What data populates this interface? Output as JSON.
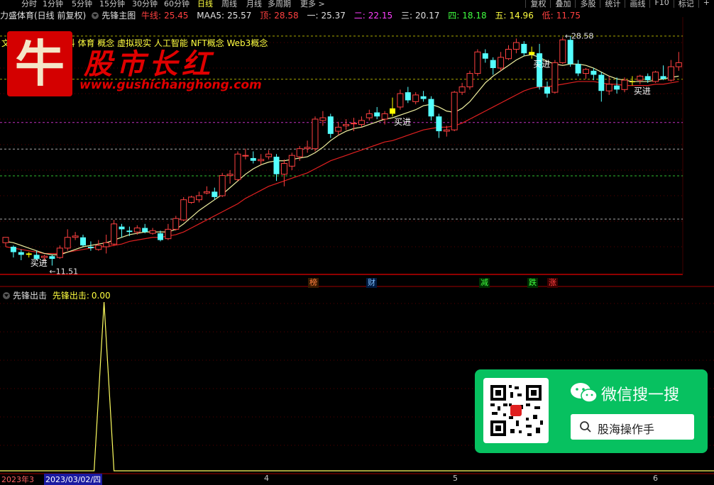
{
  "toolbar": {
    "periods": [
      "分时",
      "1分钟",
      "5分钟",
      "15分钟",
      "30分钟",
      "60分钟",
      "日线",
      "周线",
      "月线",
      "多周期",
      "更多 >"
    ],
    "active_period": "日线",
    "right_tools": [
      "复权",
      "叠加",
      "多股",
      "统计",
      "画线",
      "F10",
      "标记",
      "+"
    ]
  },
  "infobar": {
    "stock": "力盛体育(日线 前复权)",
    "indicator": "先锋主图",
    "niu_label": "牛线:",
    "niu_value": "25.45",
    "maa5_label": "MAA5:",
    "maa5_value": "25.57",
    "top_label": "顶:",
    "top_value": "28.58",
    "l1_label": "一:",
    "l1_value": "25.37",
    "l2_label": "二:",
    "l2_value": "22.15",
    "l3_label": "三:",
    "l3_value": "20.17",
    "l4_label": "四:",
    "l4_value": "18.18",
    "l5_label": "五:",
    "l5_value": "14.96",
    "low_label": "低:",
    "low_value": "11.75"
  },
  "concepts": "文旅  海板块 新材料 体育 概念 虚拟现实 人工智能 NFT概念 Web3概念",
  "watermark": {
    "logo_char": "牛",
    "title": "股市长红",
    "url": "www.gushichanghong.com"
  },
  "annotations": {
    "high_marker": "28.58",
    "low_marker": "11.51",
    "buy_label": "买进"
  },
  "event_badges": [
    {
      "text": "榜",
      "color": "#ff8040",
      "bg": "#3a1a00"
    },
    {
      "text": "财",
      "color": "#80c0ff",
      "bg": "#001a40"
    },
    {
      "text": "减",
      "color": "#40ff40",
      "bg": "#003000"
    },
    {
      "text": "跌",
      "color": "#40ff40",
      "bg": "#003000"
    },
    {
      "text": "涨",
      "color": "#ff4040",
      "bg": "#400000"
    }
  ],
  "sub_panel": {
    "name": "先锋出击",
    "value_label": "先锋出击:",
    "value": "0.00"
  },
  "date_axis": {
    "start_label": "2023年3",
    "current_date": "2023/03/02/四",
    "month_labels": [
      "4",
      "5",
      "6"
    ]
  },
  "wechat": {
    "title": "微信搜一搜",
    "search_text": "股海操作手"
  },
  "chart_data": {
    "type": "candlestick",
    "title": "力盛体育(日线 前复权)",
    "ylim": [
      11.0,
      30.0
    ],
    "candles": [
      {
        "o": 13.2,
        "h": 13.4,
        "c": 13.6,
        "l": 12.9
      },
      {
        "o": 12.9,
        "h": 13.0,
        "c": 12.5,
        "l": 12.1
      },
      {
        "o": 12.5,
        "h": 12.7,
        "c": 12.3,
        "l": 11.9
      },
      {
        "o": 12.3,
        "h": 12.5,
        "c": 12.4,
        "l": 12.1
      },
      {
        "o": 12.3,
        "h": 12.6,
        "c": 12.0,
        "l": 11.9
      },
      {
        "o": 12.1,
        "h": 12.3,
        "c": 12.2,
        "l": 11.9
      },
      {
        "o": 12.2,
        "h": 12.3,
        "c": 12.0,
        "l": 11.5
      },
      {
        "o": 12.1,
        "h": 13.0,
        "c": 12.8,
        "l": 12.0
      },
      {
        "o": 12.8,
        "h": 14.2,
        "c": 13.6,
        "l": 12.6
      },
      {
        "o": 13.6,
        "h": 14.0,
        "c": 13.7,
        "l": 13.4
      },
      {
        "o": 13.6,
        "h": 13.8,
        "c": 13.0,
        "l": 12.9
      },
      {
        "o": 12.9,
        "h": 13.3,
        "c": 12.8,
        "l": 12.6
      },
      {
        "o": 12.7,
        "h": 13.4,
        "c": 13.0,
        "l": 12.6
      },
      {
        "o": 12.9,
        "h": 13.8,
        "c": 13.2,
        "l": 12.4
      },
      {
        "o": 13.1,
        "h": 14.9,
        "c": 14.6,
        "l": 13.0
      },
      {
        "o": 14.4,
        "h": 14.6,
        "c": 14.2,
        "l": 13.6
      },
      {
        "o": 14.1,
        "h": 14.4,
        "c": 14.0,
        "l": 13.7
      },
      {
        "o": 14.0,
        "h": 14.5,
        "c": 14.3,
        "l": 13.8
      },
      {
        "o": 14.3,
        "h": 14.6,
        "c": 14.0,
        "l": 13.9
      },
      {
        "o": 13.9,
        "h": 14.3,
        "c": 14.1,
        "l": 13.8
      },
      {
        "o": 13.9,
        "h": 14.1,
        "c": 13.4,
        "l": 13.3
      },
      {
        "o": 13.5,
        "h": 14.6,
        "c": 14.2,
        "l": 13.4
      },
      {
        "o": 14.2,
        "h": 15.2,
        "c": 15.0,
        "l": 14.1
      },
      {
        "o": 14.9,
        "h": 16.6,
        "c": 16.4,
        "l": 14.8
      },
      {
        "o": 16.2,
        "h": 16.7,
        "c": 16.6,
        "l": 16.1
      },
      {
        "o": 16.4,
        "h": 17.0,
        "c": 16.7,
        "l": 16.2
      },
      {
        "o": 16.9,
        "h": 17.4,
        "c": 17.0,
        "l": 16.8
      },
      {
        "o": 17.0,
        "h": 17.3,
        "c": 16.6,
        "l": 16.4
      },
      {
        "o": 16.7,
        "h": 18.4,
        "c": 18.2,
        "l": 16.6
      },
      {
        "o": 18.2,
        "h": 18.6,
        "c": 18.3,
        "l": 17.6
      },
      {
        "o": 17.9,
        "h": 20.0,
        "c": 19.8,
        "l": 17.8
      },
      {
        "o": 19.7,
        "h": 20.2,
        "c": 19.7,
        "l": 19.4
      },
      {
        "o": 19.5,
        "h": 20.0,
        "c": 19.3,
        "l": 19.1
      },
      {
        "o": 19.3,
        "h": 19.8,
        "c": 19.4,
        "l": 19.0
      },
      {
        "o": 19.6,
        "h": 20.1,
        "c": 19.8,
        "l": 19.4
      },
      {
        "o": 19.6,
        "h": 19.8,
        "c": 18.3,
        "l": 17.8
      },
      {
        "o": 18.3,
        "h": 19.4,
        "c": 19.1,
        "l": 17.4
      },
      {
        "o": 18.9,
        "h": 19.9,
        "c": 19.7,
        "l": 18.6
      },
      {
        "o": 19.6,
        "h": 20.4,
        "c": 20.2,
        "l": 19.3
      },
      {
        "o": 20.2,
        "h": 20.8,
        "c": 20.3,
        "l": 19.9
      },
      {
        "o": 20.2,
        "h": 22.6,
        "c": 22.4,
        "l": 20.0
      },
      {
        "o": 22.3,
        "h": 23.0,
        "c": 22.5,
        "l": 21.9
      },
      {
        "o": 22.6,
        "h": 22.8,
        "c": 21.3,
        "l": 21.0
      },
      {
        "o": 21.5,
        "h": 22.2,
        "c": 21.8,
        "l": 21.2
      },
      {
        "o": 21.9,
        "h": 22.4,
        "c": 22.0,
        "l": 21.6
      },
      {
        "o": 22.1,
        "h": 22.5,
        "c": 22.1,
        "l": 21.5
      },
      {
        "o": 22.0,
        "h": 22.6,
        "c": 22.3,
        "l": 21.8
      },
      {
        "o": 22.5,
        "h": 23.1,
        "c": 22.8,
        "l": 22.3
      },
      {
        "o": 22.9,
        "h": 23.3,
        "c": 22.6,
        "l": 22.4
      },
      {
        "o": 22.4,
        "h": 23.0,
        "c": 22.8,
        "l": 22.0
      },
      {
        "o": 22.8,
        "h": 24.0,
        "c": 23.2,
        "l": 22.6
      },
      {
        "o": 23.3,
        "h": 24.6,
        "c": 24.3,
        "l": 23.1
      },
      {
        "o": 24.4,
        "h": 24.8,
        "c": 23.8,
        "l": 23.6
      },
      {
        "o": 23.7,
        "h": 24.4,
        "c": 24.2,
        "l": 23.5
      },
      {
        "o": 24.1,
        "h": 24.5,
        "c": 23.9,
        "l": 23.7
      },
      {
        "o": 23.9,
        "h": 24.1,
        "c": 22.6,
        "l": 22.3
      },
      {
        "o": 22.6,
        "h": 22.8,
        "c": 21.5,
        "l": 21.0
      },
      {
        "o": 21.5,
        "h": 21.9,
        "c": 21.6,
        "l": 21.1
      },
      {
        "o": 21.6,
        "h": 24.5,
        "c": 24.4,
        "l": 21.5
      },
      {
        "o": 24.4,
        "h": 25.1,
        "c": 24.8,
        "l": 24.2
      },
      {
        "o": 24.8,
        "h": 26.0,
        "c": 25.8,
        "l": 24.6
      },
      {
        "o": 25.8,
        "h": 27.6,
        "c": 27.4,
        "l": 25.6
      },
      {
        "o": 27.3,
        "h": 27.6,
        "c": 26.9,
        "l": 26.6
      },
      {
        "o": 26.8,
        "h": 27.0,
        "c": 26.2,
        "l": 25.7
      },
      {
        "o": 26.2,
        "h": 27.4,
        "c": 27.0,
        "l": 26.0
      },
      {
        "o": 26.9,
        "h": 27.9,
        "c": 27.6,
        "l": 26.8
      },
      {
        "o": 27.6,
        "h": 28.4,
        "c": 28.1,
        "l": 27.3
      },
      {
        "o": 28.0,
        "h": 28.2,
        "c": 27.3,
        "l": 27.1
      },
      {
        "o": 27.4,
        "h": 27.8,
        "c": 27.2,
        "l": 26.9
      },
      {
        "o": 27.3,
        "h": 28.0,
        "c": 24.8,
        "l": 24.6
      },
      {
        "o": 24.8,
        "h": 25.2,
        "c": 24.3,
        "l": 24.0
      },
      {
        "o": 24.4,
        "h": 26.8,
        "c": 26.6,
        "l": 24.3
      },
      {
        "o": 26.6,
        "h": 28.5,
        "c": 28.3,
        "l": 26.5
      },
      {
        "o": 28.3,
        "h": 28.6,
        "c": 26.5,
        "l": 26.3
      },
      {
        "o": 26.5,
        "h": 26.8,
        "c": 25.8,
        "l": 25.6
      },
      {
        "o": 25.8,
        "h": 26.2,
        "c": 26.1,
        "l": 25.4
      },
      {
        "o": 26.0,
        "h": 26.2,
        "c": 25.7,
        "l": 25.3
      },
      {
        "o": 25.7,
        "h": 25.9,
        "c": 24.5,
        "l": 23.7
      },
      {
        "o": 24.5,
        "h": 25.6,
        "c": 25.0,
        "l": 24.2
      },
      {
        "o": 24.9,
        "h": 25.5,
        "c": 24.6,
        "l": 24.3
      },
      {
        "o": 24.6,
        "h": 25.5,
        "c": 25.3,
        "l": 24.4
      },
      {
        "o": 25.2,
        "h": 25.6,
        "c": 25.2,
        "l": 24.9
      },
      {
        "o": 25.3,
        "h": 25.7,
        "c": 25.6,
        "l": 25.0
      },
      {
        "o": 25.6,
        "h": 25.8,
        "c": 25.3,
        "l": 25.1
      },
      {
        "o": 25.2,
        "h": 26.0,
        "c": 25.9,
        "l": 25.1
      },
      {
        "o": 25.6,
        "h": 26.4,
        "c": 25.4,
        "l": 25.3
      },
      {
        "o": 25.3,
        "h": 26.8,
        "c": 26.3,
        "l": 25.2
      },
      {
        "o": 26.3,
        "h": 27.4,
        "c": 26.6,
        "l": 26.0
      }
    ],
    "buy_signals": [
      3,
      50,
      68,
      81
    ],
    "ma_yellow": [
      13.3,
      13.2,
      13.0,
      12.8,
      12.6,
      12.4,
      12.3,
      12.3,
      12.5,
      12.7,
      12.9,
      13.0,
      13.1,
      13.2,
      13.4,
      13.6,
      13.8,
      13.9,
      14.0,
      14.0,
      14.0,
      14.0,
      14.2,
      14.6,
      15.1,
      15.6,
      16.0,
      16.4,
      16.8,
      17.3,
      17.8,
      18.3,
      18.7,
      19.0,
      19.2,
      19.3,
      19.3,
      19.4,
      19.5,
      19.6,
      19.9,
      20.3,
      20.8,
      21.2,
      21.5,
      21.7,
      21.8,
      22.0,
      22.2,
      22.4,
      22.5,
      22.7,
      22.9,
      23.1,
      23.4,
      23.5,
      23.3,
      23.0,
      22.9,
      23.2,
      23.7,
      24.4,
      25.1,
      25.6,
      26.0,
      26.4,
      26.8,
      27.1,
      27.2,
      27.0,
      26.7,
      26.5,
      26.4,
      26.5,
      26.5,
      26.4,
      26.2,
      25.9,
      25.6,
      25.4,
      25.3,
      25.2,
      25.2,
      25.2,
      25.3,
      25.4,
      25.5,
      25.6
    ],
    "ma_red": [
      12.9,
      12.8,
      12.7,
      12.6,
      12.5,
      12.4,
      12.4,
      12.4,
      12.5,
      12.6,
      12.7,
      12.8,
      12.9,
      12.9,
      13.0,
      13.1,
      13.3,
      13.4,
      13.5,
      13.6,
      13.6,
      13.7,
      13.8,
      14.0,
      14.3,
      14.6,
      14.9,
      15.2,
      15.5,
      15.8,
      16.1,
      16.5,
      16.8,
      17.1,
      17.4,
      17.6,
      17.8,
      18.0,
      18.2,
      18.4,
      18.7,
      19.0,
      19.3,
      19.5,
      19.7,
      19.9,
      20.1,
      20.3,
      20.5,
      20.7,
      20.8,
      21.0,
      21.2,
      21.4,
      21.6,
      21.7,
      21.8,
      21.8,
      21.9,
      22.1,
      22.4,
      22.7,
      23.0,
      23.3,
      23.6,
      23.9,
      24.2,
      24.5,
      24.7,
      24.8,
      24.8,
      24.9,
      25.0,
      25.1,
      25.2,
      25.2,
      25.2,
      25.1,
      25.0,
      25.0,
      24.9,
      24.9,
      24.9,
      24.9,
      25.0,
      25.0,
      25.1,
      25.2
    ],
    "horizontal_levels": [
      {
        "value": 28.58,
        "color": "#e0e000",
        "style": "dashed"
      },
      {
        "value": 25.37,
        "color": "#e0e000",
        "style": "dashed"
      },
      {
        "value": 22.15,
        "color": "#ff40ff",
        "style": "dashed"
      },
      {
        "value": 20.17,
        "color": "#e0e0e0",
        "style": "dashed"
      },
      {
        "value": 18.18,
        "color": "#40ff40",
        "style": "dashed"
      },
      {
        "value": 14.96,
        "color": "#e0e0e0",
        "style": "dashed"
      }
    ],
    "sub_series": {
      "name": "先锋出击",
      "spike_index": 4,
      "spike_value": 1.0,
      "ylim": [
        0,
        1
      ]
    }
  }
}
